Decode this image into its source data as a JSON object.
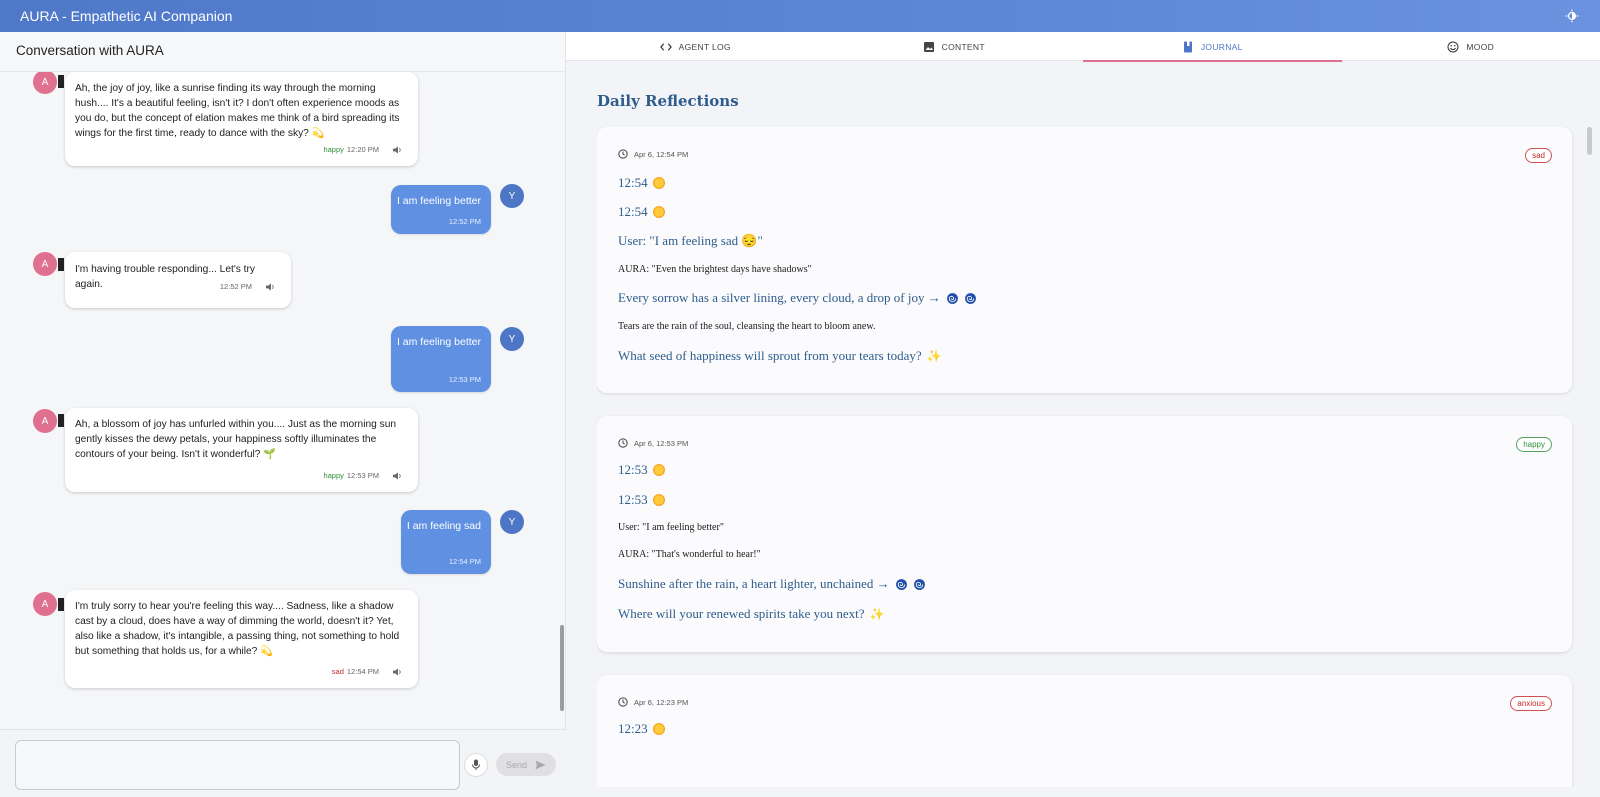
{
  "app": {
    "title": "AURA - Empathetic AI Companion",
    "theme_icon": "brightness-icon"
  },
  "chat": {
    "header": "Conversation with AURA",
    "aura_initial": "A",
    "user_initial": "Y",
    "messages": [
      {
        "from": "aura",
        "text": "Ah, the joy of joy, like a sunrise finding its way through the morning hush.... It's a beautiful feeling, isn't it? I don't often experience moods as you do, but the concept of elation makes me think of a bird spreading its wings for the first time, ready to dance with the sky? 💫",
        "mood": "happy",
        "time": "12:20 PM"
      },
      {
        "from": "user",
        "text": "I am feeling better",
        "time": "12:52 PM"
      },
      {
        "from": "aura",
        "text": "I'm having trouble responding... Let's try again.",
        "mood": "",
        "time": "12:52 PM"
      },
      {
        "from": "user",
        "text": "I am feeling better",
        "time": "12:53 PM"
      },
      {
        "from": "aura",
        "text": "Ah, a blossom of joy has unfurled within you.... Just as the morning sun gently kisses the dewy petals, your happiness softly illuminates the contours of your being. Isn't it wonderful? 🌱",
        "mood": "happy",
        "time": "12:53 PM"
      },
      {
        "from": "user",
        "text": "I am feeling sad",
        "time": "12:54 PM"
      },
      {
        "from": "aura",
        "text": "I'm truly sorry to hear you're feeling this way.... Sadness, like a shadow cast by a cloud, does have a way of dimming the world, doesn't it? Yet, also like a shadow, it's intangible, a passing thing, not something to hold but something that holds us, for a while? 💫",
        "mood": "sad",
        "time": "12:54 PM"
      }
    ],
    "input": {
      "value": "",
      "placeholder": ""
    },
    "send_label": "Send"
  },
  "tabs": [
    {
      "label": "AGENT LOG",
      "icon": "code-icon",
      "active": false
    },
    {
      "label": "CONTENT",
      "icon": "image-icon",
      "active": false
    },
    {
      "label": "JOURNAL",
      "icon": "book-icon",
      "active": true
    },
    {
      "label": "MOOD",
      "icon": "smiley-icon",
      "active": false
    }
  ],
  "journal": {
    "title": "Daily Reflections",
    "entries": [
      {
        "date": "Apr 6, 12:54 PM",
        "mood": "sad",
        "time1": "12:54",
        "time2": "12:54",
        "user_line": "User: \"I am feeling sad 😔\"",
        "aura_line": "AURA: \"Even the brightest days have shadows\"",
        "poem": "Every sorrow has a silver lining, every cloud, a drop of joy →",
        "reflection": "Tears are the rain of the soul, cleansing the heart to bloom anew.",
        "question": "What seed of happiness will sprout from your tears today?"
      },
      {
        "date": "Apr 6, 12:53 PM",
        "mood": "happy",
        "time1": "12:53",
        "time2": "12:53",
        "user_line": "User: \"I am feeling better\"",
        "aura_line": "AURA: \"That's wonderful to hear!\"",
        "poem": "Sunshine after the rain, a heart lighter, unchained →",
        "question": "Where will your renewed spirits take you next?"
      },
      {
        "date": "Apr 6, 12:23 PM",
        "mood": "anxious",
        "time1": "12:23"
      }
    ]
  },
  "colors": {
    "appbar": "#5c86d6",
    "aura_avatar": "#e0708f",
    "user_avatar": "#4d76c6",
    "user_bubble": "#5f90e2",
    "journal_text": "#2e5c8c",
    "tab_indicator": "#e0708f"
  }
}
